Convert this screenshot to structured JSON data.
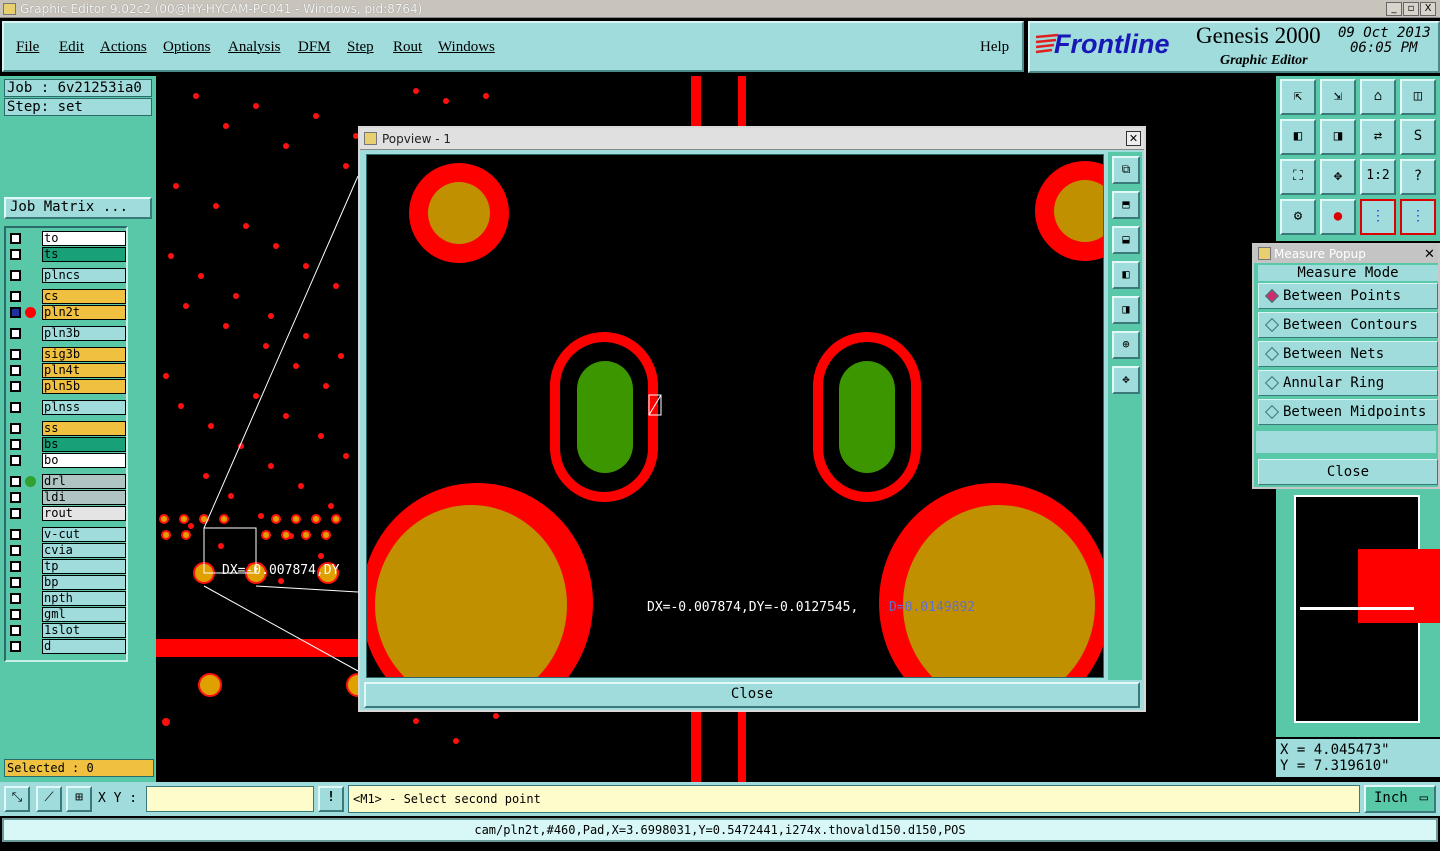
{
  "window": {
    "title": "Graphic Editor 9.02c2 (00@HY-HYCAM-PC041 - Windows, pid:8764)",
    "controls": [
      "_",
      "▫",
      "X"
    ]
  },
  "menu": {
    "items": [
      "File",
      "Edit",
      "Actions",
      "Options",
      "Analysis",
      "DFM",
      "Step",
      "Rout",
      "Windows"
    ],
    "help": "Help"
  },
  "brand": {
    "logo": "Frontline",
    "product": "Genesis 2000",
    "subtitle": "Graphic Editor",
    "date": "09 Oct 2013",
    "time": "06:05 PM",
    "colors": {
      "logo": "#1818b8",
      "accent": "#e02020"
    }
  },
  "job": {
    "job_label": "Job : 6v21253ia0",
    "step_label": "Step: set",
    "matrix_button": "Job Matrix ...",
    "selected": "Selected : 0"
  },
  "layers": [
    {
      "name": "to",
      "color": "#ffffff"
    },
    {
      "name": "ts",
      "color": "#18a078"
    },
    {
      "name": "plncs",
      "color": "#a0dcdc"
    },
    {
      "name": "cs",
      "color": "#f0c040"
    },
    {
      "name": "pln2t",
      "color": "#f0c040",
      "active": true
    },
    {
      "name": "pln3b",
      "color": "#a0dcdc"
    },
    {
      "name": "sig3b",
      "color": "#f0c040"
    },
    {
      "name": "pln4t",
      "color": "#f0c040"
    },
    {
      "name": "pln5b",
      "color": "#f0c040"
    },
    {
      "name": "plnss",
      "color": "#a0dcdc"
    },
    {
      "name": "ss",
      "color": "#f0c040"
    },
    {
      "name": "bs",
      "color": "#18a078"
    },
    {
      "name": "bo",
      "color": "#ffffff"
    },
    {
      "name": "drl",
      "color": "#b0c4c4",
      "dot": "#30a030"
    },
    {
      "name": "ldi",
      "color": "#b0c4c4"
    },
    {
      "name": "rout",
      "color": "#e4e4e4"
    },
    {
      "name": "v-cut",
      "color": "#a0dcdc"
    },
    {
      "name": "cvia",
      "color": "#a0dcdc"
    },
    {
      "name": "tp",
      "color": "#a0dcdc"
    },
    {
      "name": "bp",
      "color": "#a0dcdc"
    },
    {
      "name": "npth",
      "color": "#a0dcdc"
    },
    {
      "name": "gml",
      "color": "#a0dcdc"
    },
    {
      "name": "1slot",
      "color": "#a0dcdc"
    },
    {
      "name": "d",
      "color": "#a0dcdc"
    }
  ],
  "popview": {
    "title": "Popview - 1",
    "measure_text": "DX=-0.007874,DY=-0.0127545,",
    "measure_d": "D=0.0149892",
    "close": "Close"
  },
  "main_canvas": {
    "measure_fragment": "DX=-0.007874,DY"
  },
  "measure_popup": {
    "title": "Measure Popup",
    "heading": "Measure Mode",
    "options": [
      "Between Points",
      "Between Contours",
      "Between Nets",
      "Annular Ring",
      "Between Midpoints"
    ],
    "selected": "Between Points",
    "close": "Close"
  },
  "coords": {
    "x": "X = 4.045473\"",
    "y": "Y = 7.319610\""
  },
  "toolbar_icons": [
    "zoom-home",
    "zoom-down",
    "house",
    "panel",
    "left",
    "right",
    "swap",
    "s-shape",
    "fit",
    "center",
    "1:2",
    "help",
    "config",
    "pin",
    "net-a",
    "net-b"
  ],
  "bottom": {
    "xy_label": "X Y :",
    "xy_value": "",
    "warn_icon": "!",
    "prompt": "<M1> - Select second point",
    "unit": "Inch"
  },
  "status": "cam/pln2t,#460,Pad,X=3.6998031,Y=0.5472441,i274x.thovald150.d150,POS",
  "colors": {
    "panel": "#a0dcdc",
    "panel_dark": "#58c8a8",
    "pad_red": "#ff0000",
    "pad_gold": "#c09000",
    "slot_green": "#3c9600",
    "measure_blue": "#6070d0"
  }
}
